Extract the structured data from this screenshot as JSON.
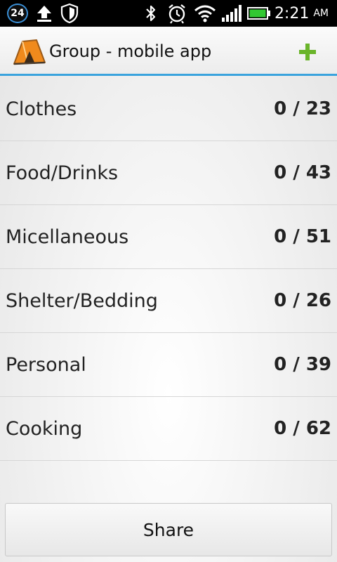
{
  "status_bar": {
    "notification_count": "24",
    "time": "2:21",
    "ampm": "AM",
    "icons": [
      "notification-badge",
      "upload-icon",
      "shield-icon",
      "bluetooth-icon",
      "alarm-icon",
      "wifi-icon",
      "signal-icon",
      "battery-icon"
    ],
    "battery_color": "#32c832"
  },
  "action_bar": {
    "title": "Group - mobile app",
    "logo": "tent-logo",
    "add_icon": "plus-icon",
    "accent_color": "#3aa3dd",
    "add_color": "#6ab42a"
  },
  "categories": [
    {
      "label": "Clothes",
      "count": "0 / 23"
    },
    {
      "label": "Food/Drinks",
      "count": "0 / 43"
    },
    {
      "label": "Micellaneous",
      "count": "0 / 51"
    },
    {
      "label": "Shelter/Bedding",
      "count": "0 / 26"
    },
    {
      "label": "Personal",
      "count": "0 / 39"
    },
    {
      "label": "Cooking",
      "count": "0 / 62"
    }
  ],
  "share_label": "Share"
}
